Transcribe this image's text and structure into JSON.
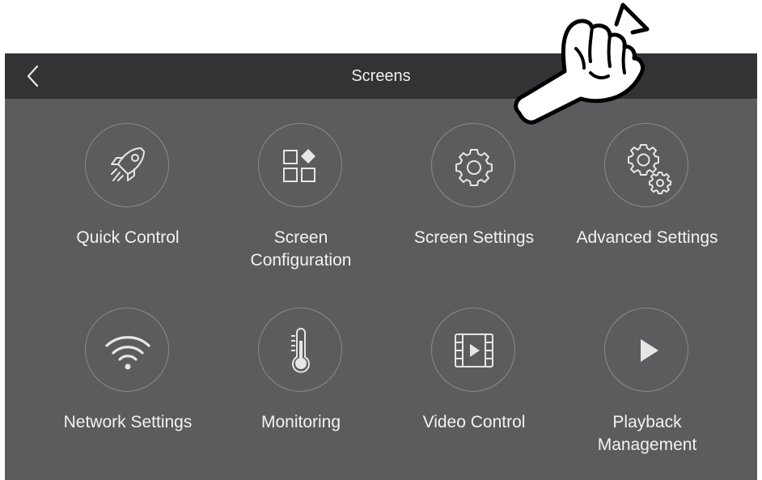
{
  "header": {
    "title": "Screens",
    "back_icon": "chevron-left-icon"
  },
  "tiles": [
    {
      "label": "Quick Control",
      "icon": "rocket-icon"
    },
    {
      "label": "Screen\nConfiguration",
      "icon": "grid-diamond-icon"
    },
    {
      "label": "Screen Settings",
      "icon": "gear-icon"
    },
    {
      "label": "Advanced Settings",
      "icon": "gears-icon"
    },
    {
      "label": "Network Settings",
      "icon": "wifi-icon"
    },
    {
      "label": "Monitoring",
      "icon": "thermometer-icon"
    },
    {
      "label": "Video Control",
      "icon": "film-icon"
    },
    {
      "label": "Playback\nManagement",
      "icon": "play-icon"
    }
  ],
  "colors": {
    "header_bg": "#333335",
    "body_bg": "#5c5c5f",
    "icon_stroke": "#e6e6e6",
    "circle_border": "#8a8a8d"
  },
  "overlay": {
    "icon": "pointing-hand-icon"
  }
}
